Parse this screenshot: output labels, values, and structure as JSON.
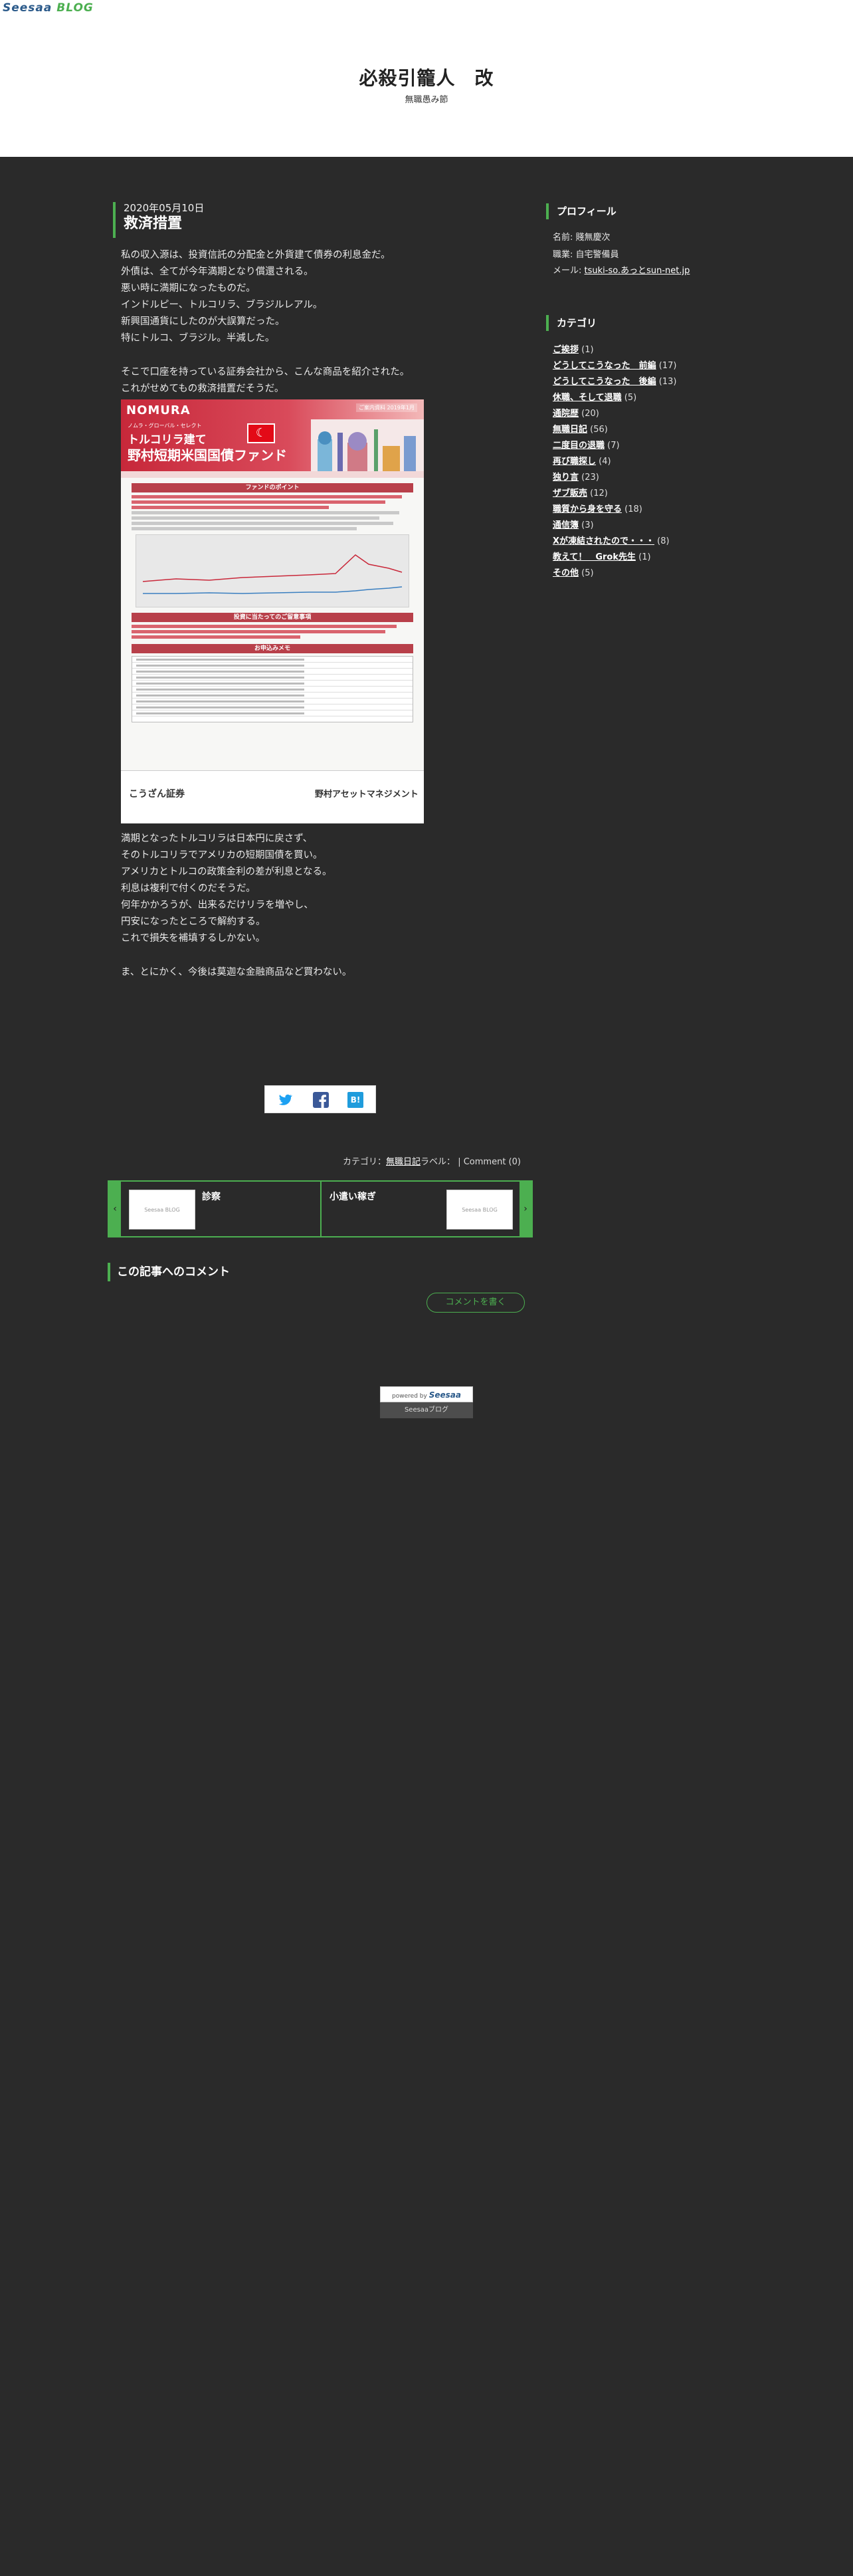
{
  "header": {
    "logo_part1": "Seesaa",
    "logo_part2": "BLOG",
    "site_title": "必殺引籠人　改",
    "site_subtitle": "無職愚み節"
  },
  "post": {
    "date": "2020年05月10日",
    "title": "救済措置",
    "paragraph1": [
      "私の収入源は、投資信託の分配金と外貨建て債券の利息金だ。",
      "外債は、全てが今年満期となり償還される。",
      "悪い時に満期になったものだ。",
      "インドルピー、トルコリラ、ブラジルレアル。",
      "新興国通貨にしたのが大誤算だった。",
      "特にトルコ、ブラジル。半減した。"
    ],
    "paragraph2": [
      "そこで口座を持っている証券会社から、こんな商品を紹介された。",
      "これがせめてもの救済措置だそうだ。"
    ],
    "paragraph3": [
      "満期となったトルコリラは日本円に戻さず、",
      "そのトルコリラでアメリカの短期国債を買い。",
      "アメリカとトルコの政策金利の差が利息となる。",
      "利息は複利で付くのだそうだ。",
      "何年かかろうが、出来るだけリラを増やし、",
      "円安になったところで解約する。",
      "これで損失を補填するしかない。"
    ],
    "paragraph4": [
      "ま、とにかく、今後は莫迦な金融商品など買わない。"
    ]
  },
  "flyer": {
    "brand": "NOMURA",
    "tag": "ご案内資料 2019年1月",
    "sub1": "ノムラ・グローバル・セレクト",
    "title1": "トルコリラ建て",
    "title2": "野村短期米国国債ファンド",
    "section1": "ファンドのポイント",
    "section2": "投資に当たってのご留意事項",
    "section3": "お申込みメモ",
    "footer_left": "こうざん証券",
    "footer_right": "野村アセットマネジメント"
  },
  "share": {
    "twitter_icon": "twitter-icon",
    "facebook_icon": "facebook-icon",
    "hatena_icon": "hatena-bookmark-icon",
    "hatena_label": "B!"
  },
  "meta": {
    "category_prefix": "カテゴリ：",
    "category_name": "無職日記",
    "label_text": "ラベル：",
    "separator": "|",
    "comment_link": "Comment (0)"
  },
  "pager": {
    "prev_arrow": "‹",
    "next_arrow": "›",
    "prev_title": "診察",
    "next_title": "小遣い稼ぎ",
    "thumb_placeholder": "Seesaa BLOG"
  },
  "comments": {
    "heading": "この記事へのコメント",
    "write_button": "コメントを書く"
  },
  "powered": {
    "prefix": "powered by",
    "brand": "Seesaa",
    "blog_link": "Seesaaブログ"
  },
  "sidebar": {
    "profile_heading": "プロフィール",
    "name": "名前: 賤無慶次",
    "job": "職業: 自宅警備員",
    "mail_prefix": "メール: ",
    "mail": "tsuki-so.あっとsun-net.jp",
    "category_heading": "カテゴリ",
    "categories": [
      {
        "name": "ご挨拶",
        "count": "(1)"
      },
      {
        "name": "どうしてこうなった　前編",
        "count": "(17)"
      },
      {
        "name": "どうしてこうなった　後編",
        "count": "(13)"
      },
      {
        "name": "休職、そして退職",
        "count": "(5)"
      },
      {
        "name": "通院歴",
        "count": "(20)"
      },
      {
        "name": "無職日記",
        "count": "(56)"
      },
      {
        "name": "二度目の退職",
        "count": "(7)"
      },
      {
        "name": "再び職探し",
        "count": "(4)"
      },
      {
        "name": "独り言",
        "count": "(23)"
      },
      {
        "name": "ザブ販売",
        "count": "(12)"
      },
      {
        "name": "職質から身を守る",
        "count": "(18)"
      },
      {
        "name": "通信簿",
        "count": "(3)"
      },
      {
        "name": "Xが凍結されたので・・・",
        "count": "(8)"
      },
      {
        "name": "教えて！　Grok先生",
        "count": "(1)"
      },
      {
        "name": "その他",
        "count": "(5)"
      }
    ]
  }
}
